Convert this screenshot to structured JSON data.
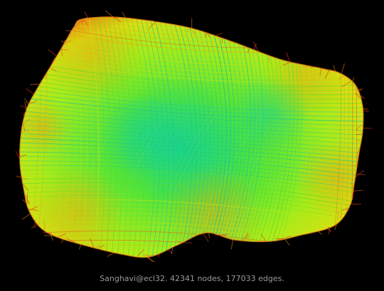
{
  "caption": "Sanghavi@ecl32. 42341 nodes, 177033 edges.",
  "graph": {
    "nodes": 42341,
    "edges": 177033,
    "palette": {
      "background": "#000000",
      "center": "#22e07a",
      "mid": "#b8ef18",
      "outer": "#d8e010",
      "rim": "#e07a10",
      "edge_red": "#e23a18",
      "caption": "#9a9a9a"
    }
  }
}
